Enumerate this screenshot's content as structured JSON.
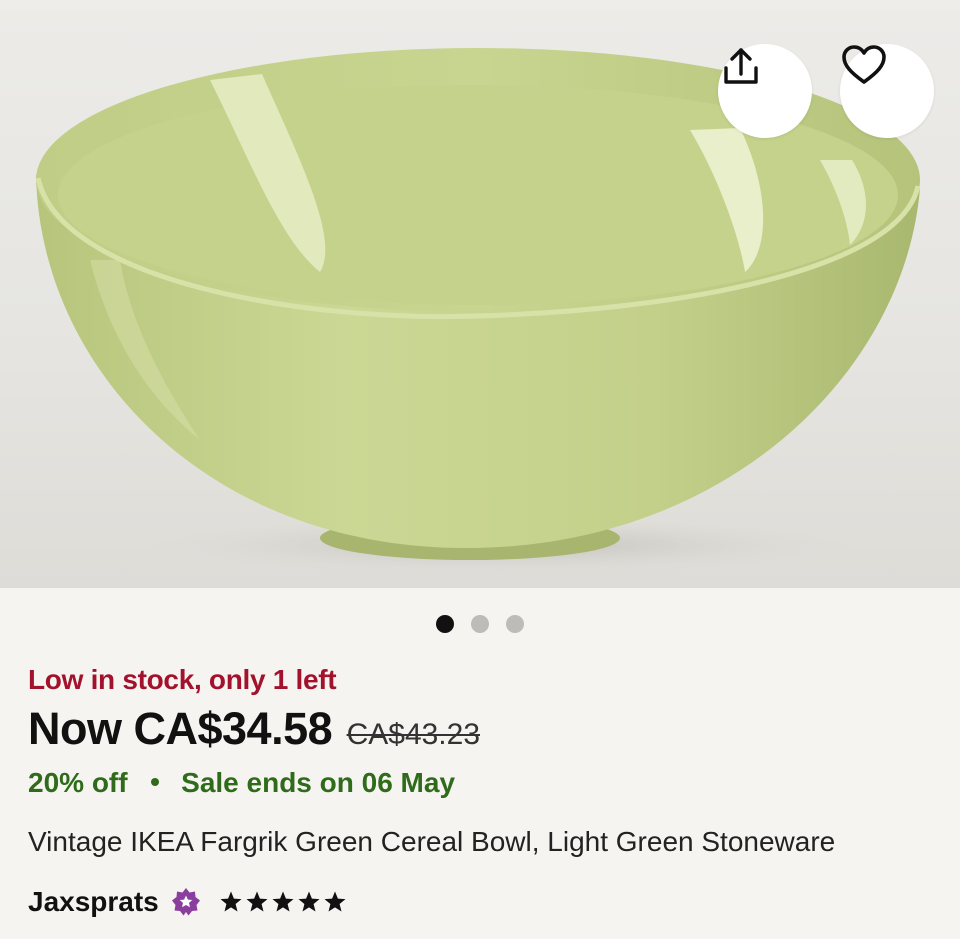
{
  "gallery": {
    "image_subject": "light green stoneware bowl",
    "image_count": 3,
    "active_index": 0
  },
  "actions": {
    "share_icon": "share-icon",
    "favorite_icon": "heart-icon"
  },
  "listing": {
    "stock_notice": "Low in stock, only 1 left",
    "price_now": "Now CA$34.58",
    "price_original": "CA$43.23",
    "discount": "20% off",
    "sale_ends": "Sale ends on 06 May",
    "title": "Vintage IKEA Fargrik Green Cereal Bowl, Light Green Stoneware"
  },
  "seller": {
    "name": "Jaxsprats",
    "badge_icon": "star-seller-badge-icon",
    "rating": 5
  },
  "colors": {
    "stock": "#a3122c",
    "sale": "#2f6b1a",
    "badge": "#8a3f9e",
    "bowl": "#c7d48e"
  }
}
